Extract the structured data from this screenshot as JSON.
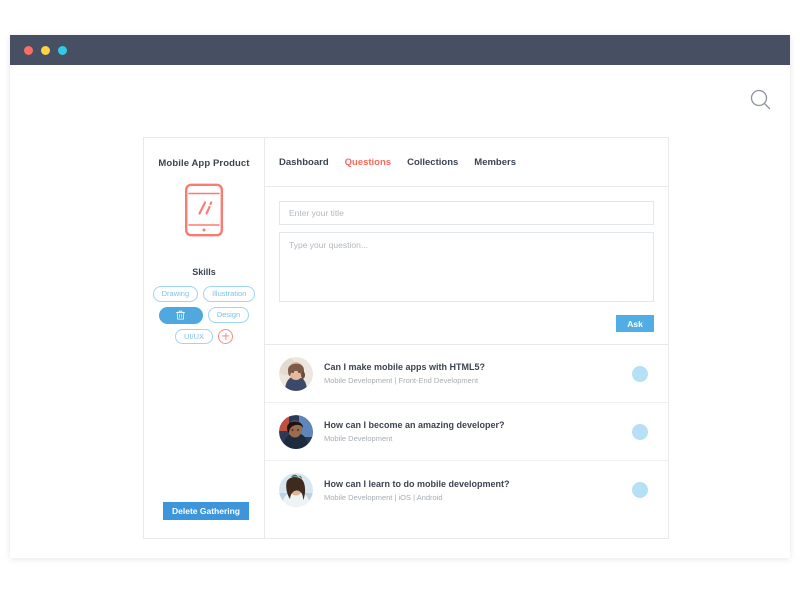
{
  "window": {
    "chrome_dots": [
      "traffic-light-red",
      "traffic-light-yellow",
      "traffic-light-cyan"
    ],
    "search_icon": "search-icon"
  },
  "colors": {
    "chrome_bar": "#474f63",
    "accent_red": "#fa6a5c",
    "accent_blue": "#51aee4",
    "tag_blue": "#7fc2ea",
    "delete_blue": "#3d96db",
    "text_dark": "#3d4451",
    "text_muted": "#a8adb5"
  },
  "sidebar": {
    "product_title": "Mobile App Product",
    "logo_icon": "mobile-phone-icon",
    "skills_label": "Skills",
    "skills": [
      {
        "label": "Drawing",
        "style": "outline"
      },
      {
        "label": "Illustration",
        "style": "outline"
      },
      {
        "label": "",
        "style": "filled",
        "icon": "trash-icon"
      },
      {
        "label": "Design",
        "style": "outline"
      },
      {
        "label": "UI/UX",
        "style": "outline"
      },
      {
        "label": "",
        "style": "add",
        "icon": "plus-icon"
      }
    ],
    "delete_button": "Delete Gathering"
  },
  "nav": {
    "tabs": [
      {
        "label": "Dashboard",
        "active": false
      },
      {
        "label": "Questions",
        "active": true
      },
      {
        "label": "Collections",
        "active": false
      },
      {
        "label": "Members",
        "active": false
      }
    ]
  },
  "compose": {
    "title_placeholder": "Enter your title",
    "title_value": "",
    "body_placeholder": "Type your question...",
    "body_value": "",
    "ask_label": "Ask"
  },
  "questions": [
    {
      "title": "Can I make mobile apps with HTML5?",
      "meta": "Mobile Development | Front-End Development",
      "avatar": "user-avatar"
    },
    {
      "title": "How can I become an amazing developer?",
      "meta": "Mobile Development",
      "avatar": "user-avatar"
    },
    {
      "title": "How can I learn to do mobile development?",
      "meta": "Mobile Development | iOS | Android",
      "avatar": "user-avatar"
    }
  ]
}
